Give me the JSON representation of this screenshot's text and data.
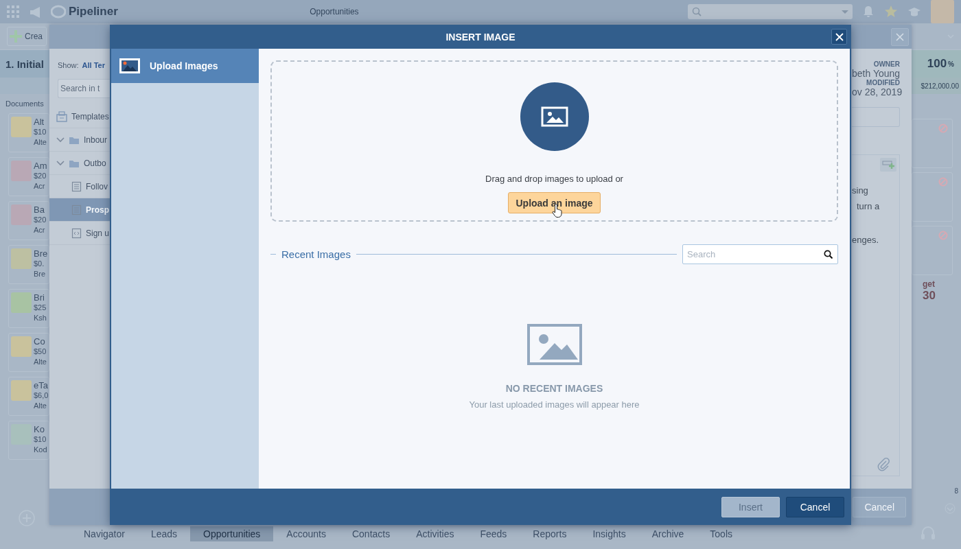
{
  "app": {
    "brand": "Pipeliner",
    "title": "Opportunities",
    "create_label": "Crea",
    "stage": "1. Initial",
    "documents_label": "Documents",
    "documents": [
      {
        "name": "Alt",
        "amount": "$10",
        "company": "Alte"
      },
      {
        "name": "Am",
        "amount": "$20",
        "company": "Acr"
      },
      {
        "name": "Ba",
        "amount": "$20",
        "company": "Acr"
      },
      {
        "name": "Bre",
        "amount": "$0.",
        "company": "Bre"
      },
      {
        "name": "Bri",
        "amount": "$25",
        "company": "Ksh"
      },
      {
        "name": "Co",
        "amount": "$50",
        "company": "Alte"
      },
      {
        "name": "eTa",
        "amount": "$6,0",
        "company": "Alte"
      },
      {
        "name": "Ko",
        "amount": "$10",
        "company": "Kod"
      }
    ],
    "percent": "100",
    "percent_unit": "%",
    "total": "$212,000.00",
    "target_label": "get",
    "target_value": "30",
    "page_count": "8",
    "nav": [
      {
        "label": "Navigator",
        "selected": false
      },
      {
        "label": "Leads",
        "selected": false
      },
      {
        "label": "Opportunities",
        "selected": true
      },
      {
        "label": "Accounts",
        "selected": false
      },
      {
        "label": "Contacts",
        "selected": false
      },
      {
        "label": "Activities",
        "selected": false
      },
      {
        "label": "Feeds",
        "selected": false
      },
      {
        "label": "Reports",
        "selected": false
      },
      {
        "label": "Insights",
        "selected": false
      },
      {
        "label": "Archive",
        "selected": false
      },
      {
        "label": "Tools",
        "selected": false
      }
    ]
  },
  "template_dialog": {
    "show_label": "Show:",
    "show_value": "All Ter",
    "search_placeholder": "Search in t",
    "tree": [
      {
        "label": "Templates",
        "kind": "root"
      },
      {
        "label": "Inbour",
        "kind": "folder",
        "expanded": true
      },
      {
        "label": "Outbo",
        "kind": "folder",
        "expanded": true,
        "children": [
          {
            "label": "Follov",
            "kind": "doc",
            "selected": false
          },
          {
            "label": "Prosp",
            "kind": "doc",
            "selected": true
          },
          {
            "label": "Sign u",
            "kind": "code",
            "selected": false
          }
        ]
      }
    ],
    "owner_label": "OWNER",
    "owner": "beth Young",
    "modified_label": "MODIFIED",
    "modified": "ov 28, 2019",
    "body_lines": [
      "sing",
      "turn a",
      "enges."
    ],
    "cancel": "Cancel"
  },
  "modal": {
    "title": "INSERT IMAGE",
    "sidebar": [
      {
        "label": "Upload Images",
        "selected": true
      }
    ],
    "drop_text": "Drag and drop images to upload or",
    "upload_button": "Upload an image",
    "recent_title": "Recent Images",
    "search_placeholder": "Search",
    "empty_title": "NO RECENT IMAGES",
    "empty_text": "Your last uploaded images will appear here",
    "buttons": [
      {
        "label": "Insert",
        "disabled": true
      },
      {
        "label": "Cancel",
        "disabled": false
      }
    ]
  }
}
